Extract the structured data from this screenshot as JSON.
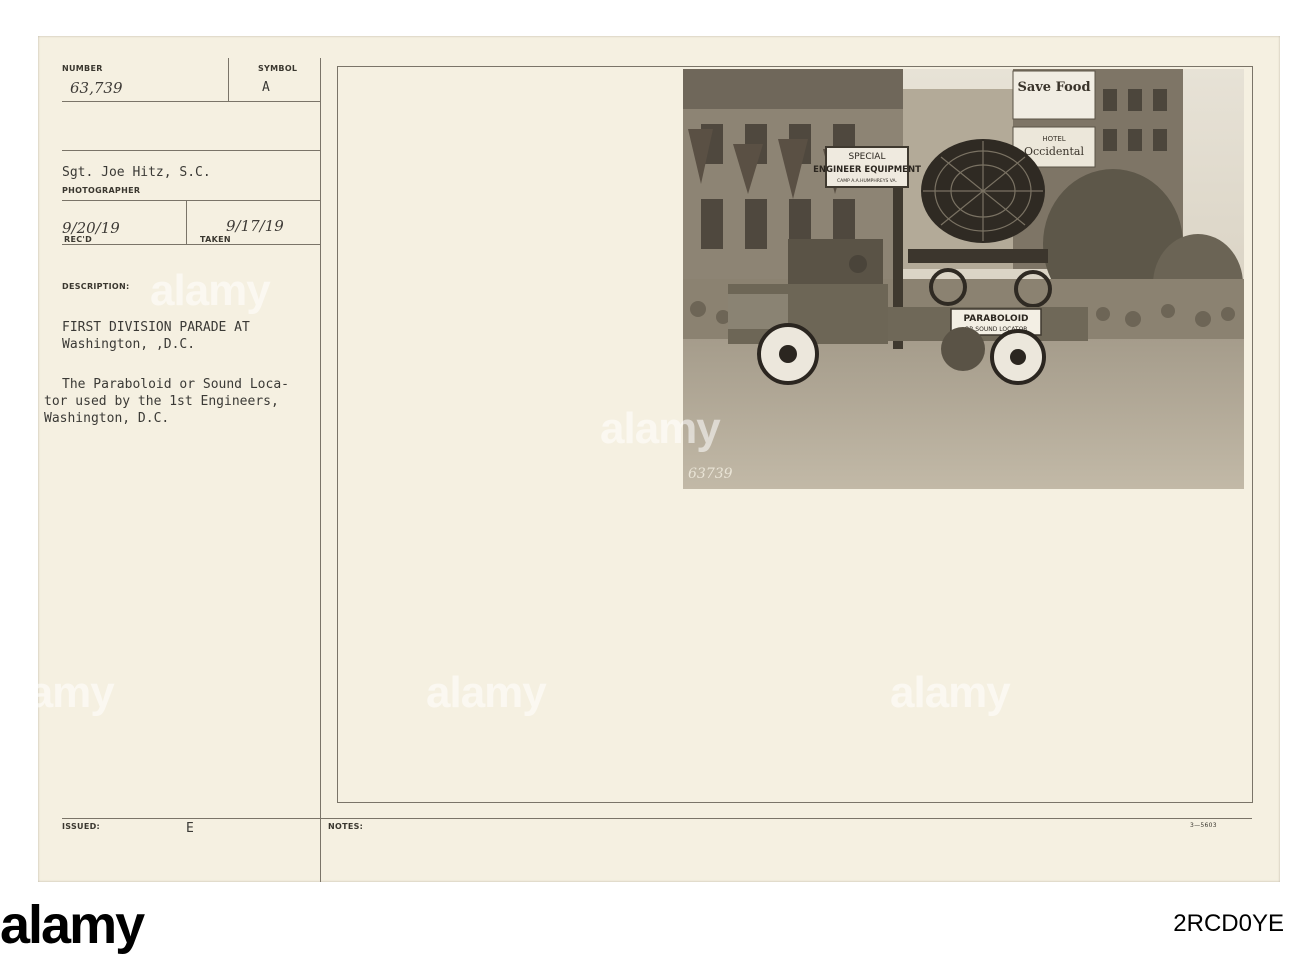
{
  "card": {
    "number_label": "NUMBER",
    "number_value": "63,739",
    "symbol_label": "SYMBOL",
    "symbol_value": "A",
    "photographer_value": "Sgt. Joe Hitz, S.C.",
    "photographer_label": "PHOTOGRAPHER",
    "recd_value": "9/20/19",
    "recd_label": "REC'D",
    "taken_label": "TAKEN",
    "taken_value": "9/17/19",
    "description_label": "DESCRIPTION:",
    "description_title_line1": "FIRST DIVISION PARADE AT",
    "description_title_line2": "Washington, ,D.C.",
    "description_body_line1": "The Paraboloid or Sound Loca-",
    "description_body_line2": "tor used by the 1st Engineers,",
    "description_body_line3": "Washington, D.C.",
    "issued_label": "ISSUED:",
    "issued_value": "E",
    "notes_label": "NOTES:",
    "form_code": "3—5603"
  },
  "photo": {
    "sign_line1": "SPECIAL",
    "sign_line2": "ENGINEER EQUIPMENT",
    "sign_line3": "CAMP A.A.HUMPHREYS VA.",
    "truck_sign_line1": "PARABOLOID",
    "truck_sign_line2": "OR SOUND LOCATOR",
    "billboard_line1": "Save Food",
    "hotel_line1": "HOTEL",
    "hotel_line2": "Occidental",
    "negative_number": "63739"
  },
  "watermark": {
    "text": "alamy"
  },
  "footer": {
    "brand": "alamy",
    "image_id": "2RCD0YE"
  }
}
